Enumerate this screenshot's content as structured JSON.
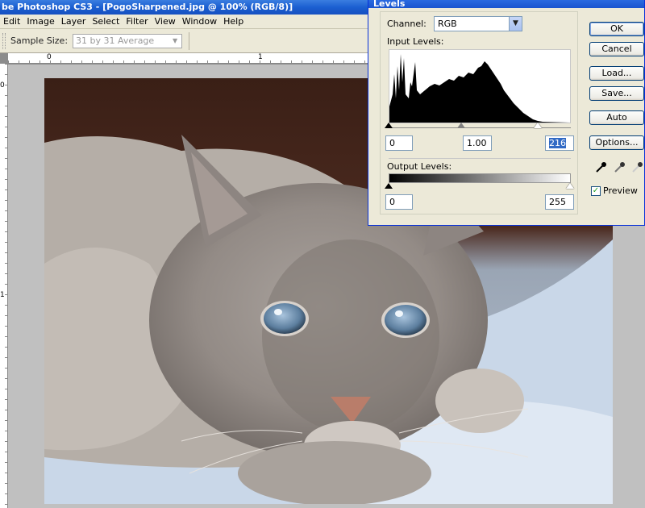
{
  "app": {
    "title": "be Photoshop CS3 - [PogoSharpened.jpg @ 100% (RGB/8)]"
  },
  "menu": [
    "Edit",
    "Image",
    "Layer",
    "Select",
    "Filter",
    "View",
    "Window",
    "Help"
  ],
  "options_bar": {
    "sample_size_label": "Sample Size:",
    "sample_size_value": "31 by 31 Average"
  },
  "rulers": {
    "top_labels": [
      "0",
      "1"
    ],
    "left_labels": [
      "0",
      "1"
    ]
  },
  "levels_dialog": {
    "title": "Levels",
    "channel_label": "Channel:",
    "channel_value": "RGB",
    "input_levels_label": "Input Levels:",
    "input_black": "0",
    "input_gamma": "1.00",
    "input_white": "216",
    "output_levels_label": "Output Levels:",
    "output_black": "0",
    "output_white": "255",
    "buttons": {
      "ok": "OK",
      "cancel": "Cancel",
      "load": "Load...",
      "save": "Save...",
      "auto": "Auto",
      "options": "Options..."
    },
    "preview_label": "Preview",
    "preview_checked": true
  },
  "colors": {
    "title_bar": "#1b5fd1",
    "dialog_bg": "#ece9d8",
    "selection": "#316ac5"
  }
}
